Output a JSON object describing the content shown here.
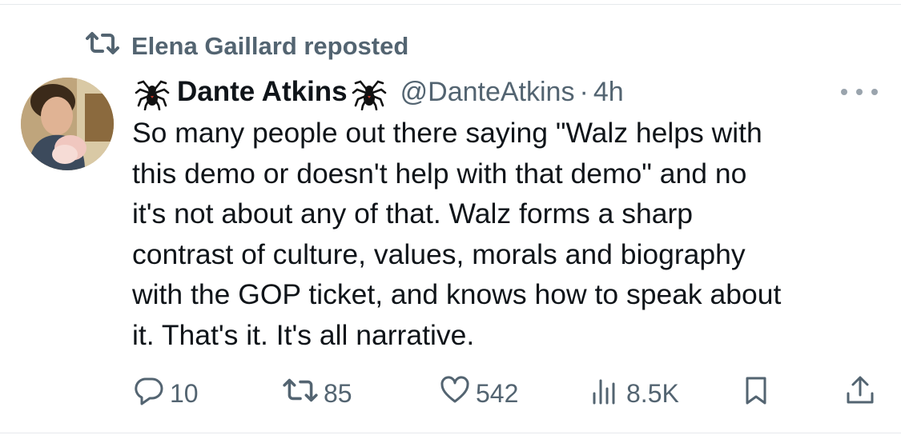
{
  "repost_label": "Elena Gaillard reposted",
  "author": {
    "name": "Dante Atkins",
    "handle": "@DanteAtkins",
    "separator": "·",
    "time": "4h"
  },
  "tweet_text": "So many people out there saying \"Walz helps with\nthis demo or doesn't help with that demo\" and no\nit's not about any of that. Walz forms a sharp\ncontrast of culture, values, morals and biography\nwith the GOP ticket, and knows how to speak about\nit. That's it. It's all narrative.",
  "actions": {
    "replies": "10",
    "reposts": "85",
    "likes": "542",
    "views": "8.5K"
  },
  "colors": {
    "text": "#0f1419",
    "secondary": "#536471"
  },
  "icons": [
    "repost-icon",
    "spider-emoji-icon",
    "more-icon",
    "reply-icon",
    "retweet-icon",
    "like-icon",
    "views-icon",
    "bookmark-icon",
    "share-icon"
  ]
}
